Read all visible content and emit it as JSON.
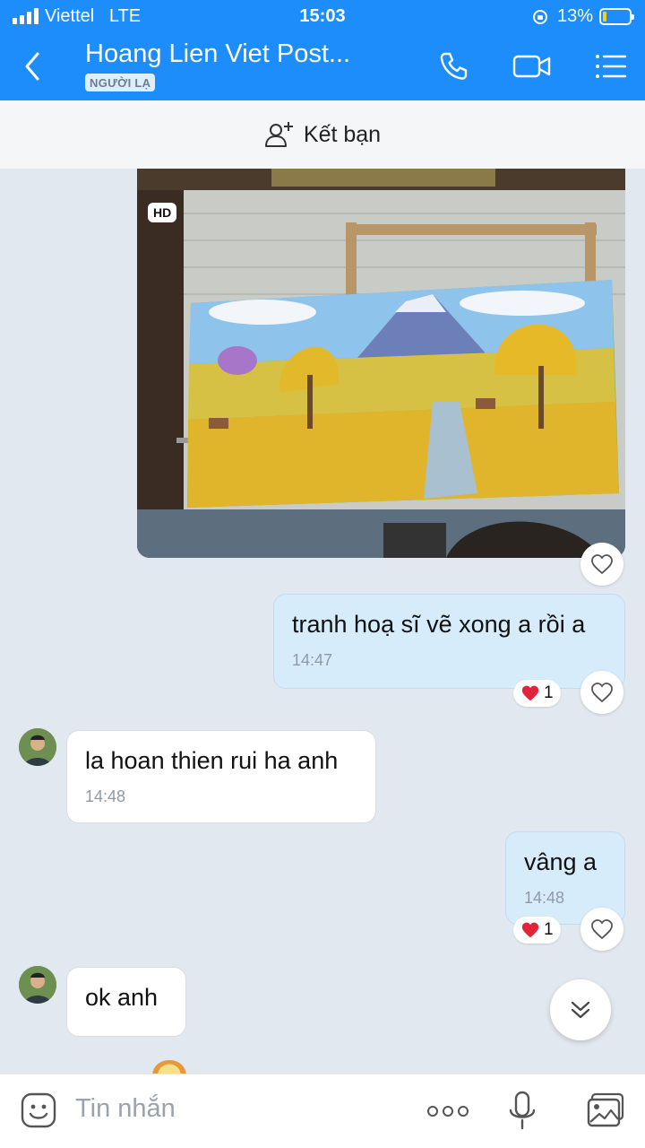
{
  "status_bar": {
    "carrier": "Viettel",
    "network": "LTE",
    "time": "15:03",
    "battery": "13%",
    "battery_level": 0.13
  },
  "header": {
    "title": "Hoang Lien Viet Post...",
    "tag": "NGƯỜI LẠ",
    "icons": [
      "back-icon",
      "phone-icon",
      "video-icon",
      "menu-icon"
    ]
  },
  "friend_bar": {
    "label": "Kết bạn",
    "icon": "add-person-icon"
  },
  "photo": {
    "badge": "HD"
  },
  "messages": [
    {
      "from": "me",
      "text": "tranh hoạ sĩ vẽ xong a rồi a",
      "time": "14:47",
      "reaction": "❤️",
      "reaction_count": "1"
    },
    {
      "from": "them",
      "text": "la hoan thien rui ha anh",
      "time": "14:48"
    },
    {
      "from": "me",
      "text": "vâng a",
      "time": "14:48",
      "reaction": "❤️",
      "reaction_count": "1"
    },
    {
      "from": "them",
      "text": "ok anh"
    }
  ],
  "input": {
    "placeholder": "Tin nhắn",
    "icons": [
      "emoji-icon",
      "more-icon",
      "microphone-icon",
      "image-icon"
    ]
  },
  "colors": {
    "header_bg": "#1c8dfb",
    "chat_bg": "#e2e8ef",
    "my_bubble": "#d6ecfb",
    "their_bubble": "#ffffff",
    "heart": "#e0243a"
  }
}
